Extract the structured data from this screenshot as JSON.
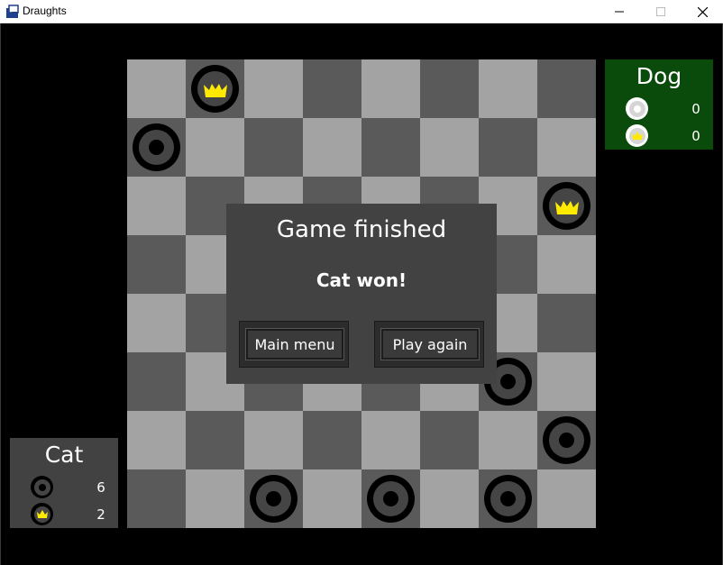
{
  "window": {
    "title": "Draughts",
    "icon": "draughts-app-icon",
    "controls": [
      "minimize",
      "maximize",
      "close"
    ]
  },
  "colors": {
    "board_light": "#a3a3a3",
    "board_dark": "#5a5a5a",
    "dog_panel": "#0a4a0a",
    "cat_panel": "#424242",
    "dialog": "#424242",
    "crown": "#ffea00"
  },
  "board": {
    "size": 8,
    "pieces": [
      {
        "row": 0,
        "col": 1,
        "color": "black",
        "king": true
      },
      {
        "row": 1,
        "col": 0,
        "color": "black",
        "king": false
      },
      {
        "row": 2,
        "col": 7,
        "color": "black",
        "king": true
      },
      {
        "row": 5,
        "col": 6,
        "color": "black",
        "king": false
      },
      {
        "row": 6,
        "col": 7,
        "color": "black",
        "king": false
      },
      {
        "row": 7,
        "col": 2,
        "color": "black",
        "king": false
      },
      {
        "row": 7,
        "col": 4,
        "color": "black",
        "king": false
      },
      {
        "row": 7,
        "col": 6,
        "color": "black",
        "king": false
      }
    ]
  },
  "players": {
    "dog": {
      "name": "Dog",
      "men": "0",
      "kings": "0",
      "piece_color": "white"
    },
    "cat": {
      "name": "Cat",
      "men": "6",
      "kings": "2",
      "piece_color": "black"
    }
  },
  "dialog": {
    "title": "Game finished",
    "message": "Cat won!",
    "main_menu_label": "Main menu",
    "play_again_label": "Play again"
  }
}
